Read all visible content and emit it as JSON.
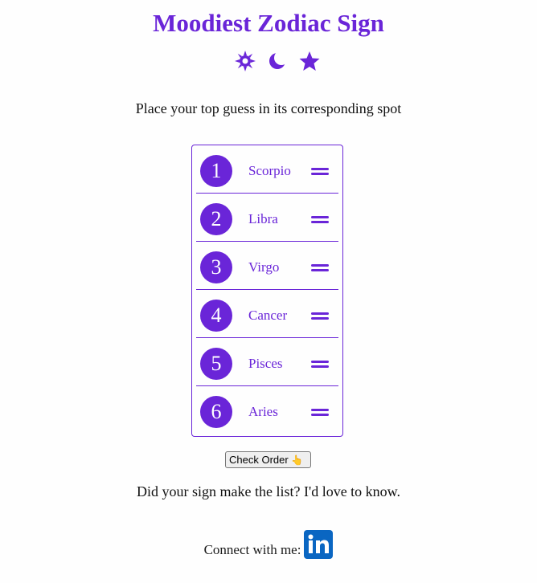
{
  "page": {
    "title": "Moodiest Zodiac Sign",
    "instructions": "Place your top guess in its corresponding spot",
    "question": "Did your sign make the list? I'd love to know.",
    "accent_color": "#6a25d8"
  },
  "icons": [
    "sun-icon",
    "moon-icon",
    "star-icon"
  ],
  "ranking": {
    "items": [
      {
        "rank": "1",
        "sign": "Scorpio"
      },
      {
        "rank": "2",
        "sign": "Libra"
      },
      {
        "rank": "3",
        "sign": "Virgo"
      },
      {
        "rank": "4",
        "sign": "Cancer"
      },
      {
        "rank": "5",
        "sign": "Pisces"
      },
      {
        "rank": "6",
        "sign": "Aries"
      }
    ]
  },
  "actions": {
    "check_label": "Check Order",
    "check_icon": "pointing-hand-icon"
  },
  "footer": {
    "connect_label": "Connect with me:",
    "social_icon": "linkedin-icon",
    "social_icon_text": "in"
  }
}
